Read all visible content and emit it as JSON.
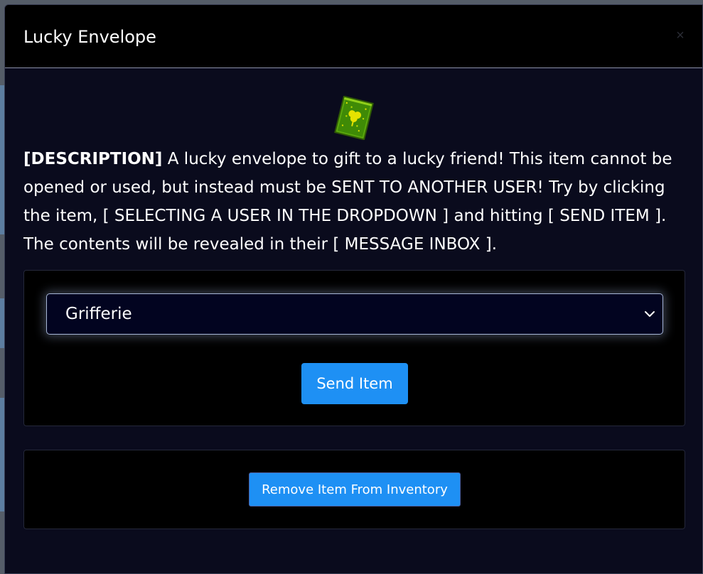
{
  "modal": {
    "title": "Lucky Envelope",
    "close_symbol": "×"
  },
  "item": {
    "icon": "lucky-envelope-icon",
    "description_label": "[DESCRIPTION]",
    "description_text": " A lucky envelope to gift to a lucky friend! This item cannot be opened or used, but instead must be SENT TO ANOTHER USER! Try by clicking the item, [ SELECTING A USER IN THE DROPDOWN ] and hitting [ SEND ITEM ]. The contents will be revealed in their [ MESSAGE INBOX ]."
  },
  "send_form": {
    "selected_user": "Grifferie",
    "send_label": "Send Item"
  },
  "remove": {
    "label": "Remove Item From Inventory"
  },
  "colors": {
    "primary_button": "#1e90f4",
    "modal_bg": "#0a0b1d",
    "panel_bg": "#000000",
    "envelope_green": "#5aa80c",
    "envelope_yellow": "#e6e200"
  }
}
